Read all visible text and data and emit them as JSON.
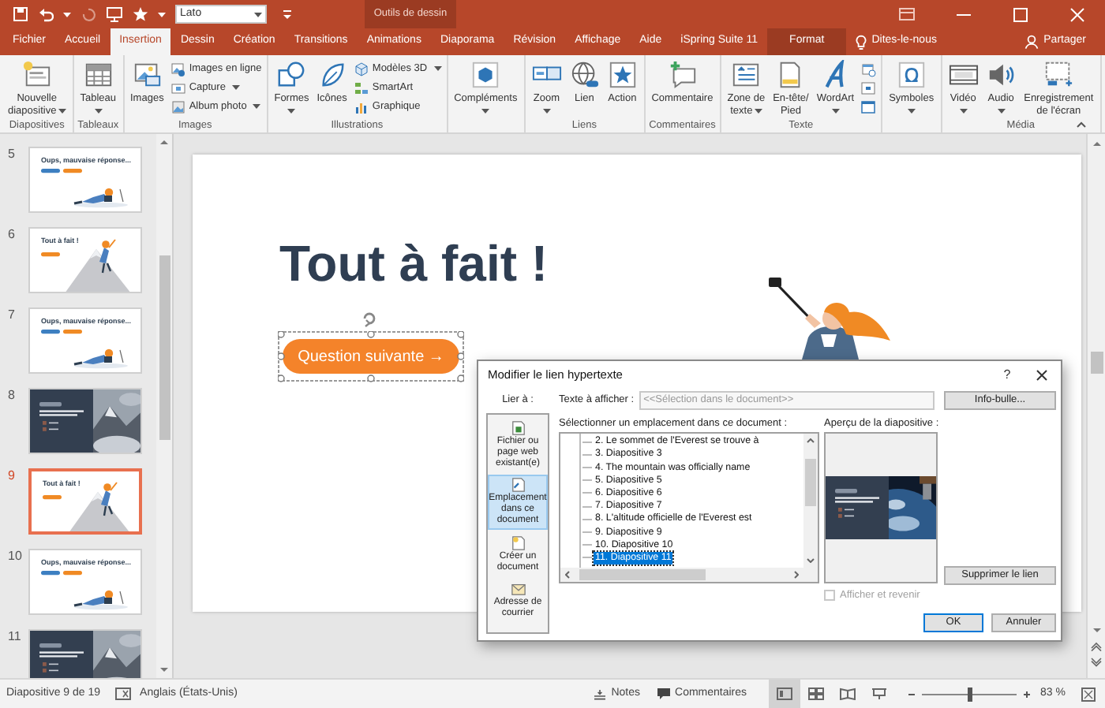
{
  "title_bar": {
    "font_box": "Lato",
    "context_group": "Outils de dessin"
  },
  "tabs": [
    {
      "label": "Fichier",
      "selected": false,
      "kind": "normal"
    },
    {
      "label": "Accueil",
      "selected": false,
      "kind": "normal"
    },
    {
      "label": "Insertion",
      "selected": true,
      "kind": "normal"
    },
    {
      "label": "Dessin",
      "selected": false,
      "kind": "normal"
    },
    {
      "label": "Création",
      "selected": false,
      "kind": "normal"
    },
    {
      "label": "Transitions",
      "selected": false,
      "kind": "normal"
    },
    {
      "label": "Animations",
      "selected": false,
      "kind": "normal"
    },
    {
      "label": "Diaporama",
      "selected": false,
      "kind": "normal"
    },
    {
      "label": "Révision",
      "selected": false,
      "kind": "normal"
    },
    {
      "label": "Affichage",
      "selected": false,
      "kind": "normal"
    },
    {
      "label": "Aide",
      "selected": false,
      "kind": "normal"
    },
    {
      "label": "iSpring Suite 11",
      "selected": false,
      "kind": "normal"
    },
    {
      "label": "Format",
      "selected": false,
      "kind": "context"
    }
  ],
  "tell_me": "Dites-le-nous",
  "share": "Partager",
  "ribbon_groups": [
    {
      "label": "Diapositives",
      "commands": [
        {
          "kind": "large",
          "lines": [
            "Nouvelle",
            "diapositive"
          ],
          "dropdown": true
        }
      ]
    },
    {
      "label": "Tableaux",
      "commands": [
        {
          "kind": "large",
          "lines": [
            "Tableau"
          ],
          "dropdown": true
        }
      ]
    },
    {
      "label": "Images",
      "commands": [
        {
          "kind": "large",
          "lines": [
            "Images"
          ],
          "dropdown": false
        },
        {
          "kind": "small",
          "label": "Images en ligne",
          "dropdown": false
        },
        {
          "kind": "small",
          "label": "Capture",
          "dropdown": true
        },
        {
          "kind": "small",
          "label": "Album photo",
          "dropdown": true
        }
      ]
    },
    {
      "label": "Illustrations",
      "commands": [
        {
          "kind": "large",
          "lines": [
            "Formes"
          ],
          "dropdown": true
        },
        {
          "kind": "large",
          "lines": [
            "Icônes"
          ],
          "dropdown": false
        },
        {
          "kind": "small",
          "label": "Modèles 3D",
          "dropdown": true
        },
        {
          "kind": "small",
          "label": "SmartArt",
          "dropdown": false
        },
        {
          "kind": "small",
          "label": "Graphique",
          "dropdown": false
        }
      ]
    },
    {
      "commands": [
        {
          "kind": "large",
          "lines": [
            "Compléments"
          ],
          "dropdown": true
        }
      ]
    },
    {
      "label": "Liens",
      "commands": [
        {
          "kind": "large",
          "lines": [
            "Zoom"
          ],
          "dropdown": true
        },
        {
          "kind": "large",
          "lines": [
            "Lien"
          ],
          "dropdown": false
        },
        {
          "kind": "large",
          "lines": [
            "Action"
          ],
          "dropdown": false
        }
      ]
    },
    {
      "label": "Commentaires",
      "commands": [
        {
          "kind": "large",
          "lines": [
            "Commentaire"
          ],
          "dropdown": false
        }
      ]
    },
    {
      "label": "Texte",
      "commands": [
        {
          "kind": "large",
          "lines": [
            "Zone de",
            "texte"
          ],
          "dropdown": true
        },
        {
          "kind": "large",
          "lines": [
            "En-tête/",
            "Pied"
          ],
          "dropdown": false
        },
        {
          "kind": "large",
          "lines": [
            "WordArt"
          ],
          "dropdown": true
        },
        {
          "kind": "icon_only"
        },
        {
          "kind": "icon_only"
        },
        {
          "kind": "icon_only"
        }
      ]
    },
    {
      "commands": [
        {
          "kind": "large",
          "lines": [
            "Symboles"
          ],
          "dropdown": true
        }
      ]
    },
    {
      "label": "Média",
      "commands": [
        {
          "kind": "large",
          "lines": [
            "Vidéo"
          ],
          "dropdown": true
        },
        {
          "kind": "large",
          "lines": [
            "Audio"
          ],
          "dropdown": true
        },
        {
          "kind": "large",
          "lines": [
            "Enregistrement",
            "de l'écran"
          ],
          "dropdown": false
        }
      ]
    }
  ],
  "slides": [
    {
      "number": "5",
      "kind": "wrong",
      "title": "Oups, mauvaise réponse...",
      "selected": false
    },
    {
      "number": "6",
      "kind": "right",
      "title": "Tout à fait !",
      "selected": false
    },
    {
      "number": "7",
      "kind": "wrong",
      "title": "Oups, mauvaise réponse...",
      "selected": false
    },
    {
      "number": "8",
      "kind": "dark",
      "selected": false
    },
    {
      "number": "9",
      "kind": "right",
      "title": "Tout à fait !",
      "selected": true
    },
    {
      "number": "10",
      "kind": "wrong",
      "title": "Oups, mauvaise réponse...",
      "selected": false
    },
    {
      "number": "11",
      "kind": "dark",
      "selected": false
    }
  ],
  "slide": {
    "title": "Tout à fait !",
    "button": "Question suivante →",
    "button_selected": true
  },
  "dialog": {
    "title": "Modifier le lien hypertexte",
    "help": "?",
    "link_to_label": "Lier à :",
    "link_targets": [
      {
        "label": "Fichier ou page web existant(e)",
        "selected": false
      },
      {
        "label": "Emplacement dans ce document",
        "selected": true
      },
      {
        "label": "Créer un document",
        "selected": false
      },
      {
        "label": "Adresse de courrier",
        "selected": false
      }
    ],
    "display_text_label": "Texte à afficher :",
    "display_text_value": "<<Sélection dans le document>>",
    "tooltip_button": "Info-bulle...",
    "place_label": "Sélectionner un emplacement dans ce document :",
    "places": [
      {
        "label": "2. Le sommet de l'Everest se trouve à",
        "selected": false
      },
      {
        "label": "3. Diapositive 3",
        "selected": false
      },
      {
        "label": "4. The mountain was officially name",
        "selected": false
      },
      {
        "label": "5. Diapositive 5",
        "selected": false
      },
      {
        "label": "6. Diapositive 6",
        "selected": false
      },
      {
        "label": "7. Diapositive 7",
        "selected": false
      },
      {
        "label": "8. L'altitude officielle de l'Everest est",
        "selected": false
      },
      {
        "label": "9. Diapositive 9",
        "selected": false
      },
      {
        "label": "10. Diapositive 10",
        "selected": false
      },
      {
        "label": "11. Diapositive 11",
        "selected": true
      }
    ],
    "preview_label": "Aperçu de la diapositive :",
    "show_and_return": {
      "label": "Afficher et revenir",
      "checked": false,
      "disabled": true
    },
    "remove_button": "Supprimer le lien",
    "ok_button": "OK",
    "cancel_button": "Annuler"
  },
  "status_bar": {
    "slide_position": "Diapositive 9 de 19",
    "language": "Anglais (États-Unis)",
    "notes": "Notes",
    "comments": "Commentaires",
    "views": [
      {
        "selected": true
      },
      {
        "selected": false
      },
      {
        "selected": false
      },
      {
        "selected": false
      }
    ],
    "zoom": {
      "level": 0.5,
      "reading": "83 %"
    }
  }
}
